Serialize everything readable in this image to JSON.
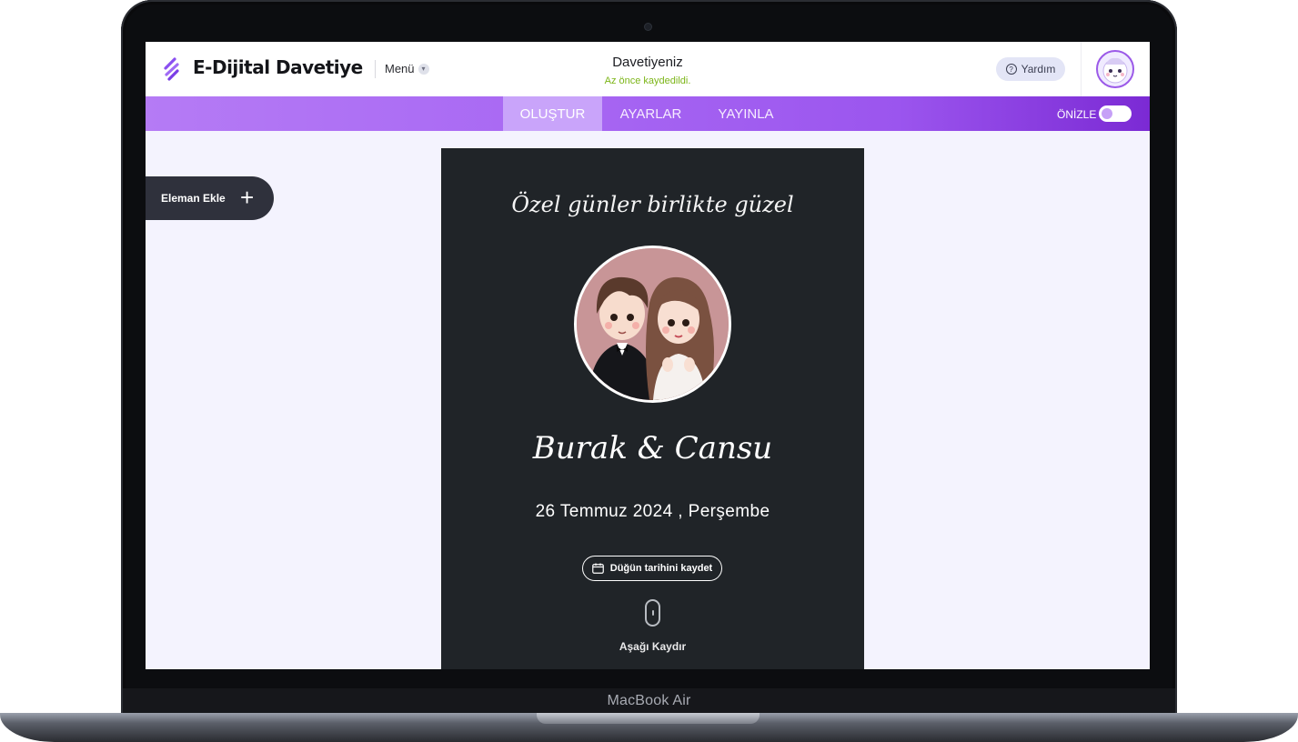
{
  "device": {
    "label": "MacBook Air"
  },
  "header": {
    "brand": "E-Dijital Davetiye",
    "menu_label": "Menü",
    "document_title": "Davetiyeniz",
    "save_status": "Az önce kaydedildi.",
    "help_label": "Yardım"
  },
  "nav": {
    "tabs": [
      {
        "label": "OLUŞTUR",
        "active": true
      },
      {
        "label": "AYARLAR",
        "active": false
      },
      {
        "label": "YAYINLA",
        "active": false
      }
    ],
    "preview_label": "ÖNİZLE",
    "preview_enabled": true
  },
  "sidebar": {
    "add_element_label": "Eleman Ekle"
  },
  "invitation": {
    "tagline": "Özel günler birlikte güzel",
    "couple_names": "Burak & Cansu",
    "date": "26 Temmuz 2024 , Perşembe",
    "save_date_label": "Düğün tarihini kaydet",
    "scroll_hint": "Aşağı Kaydır"
  },
  "colors": {
    "accent": "#a868f3",
    "accent_dark": "#7b2ad4",
    "card_background": "#202428",
    "canvas_background": "#f4f3fe",
    "saved_status": "#7cb518"
  }
}
